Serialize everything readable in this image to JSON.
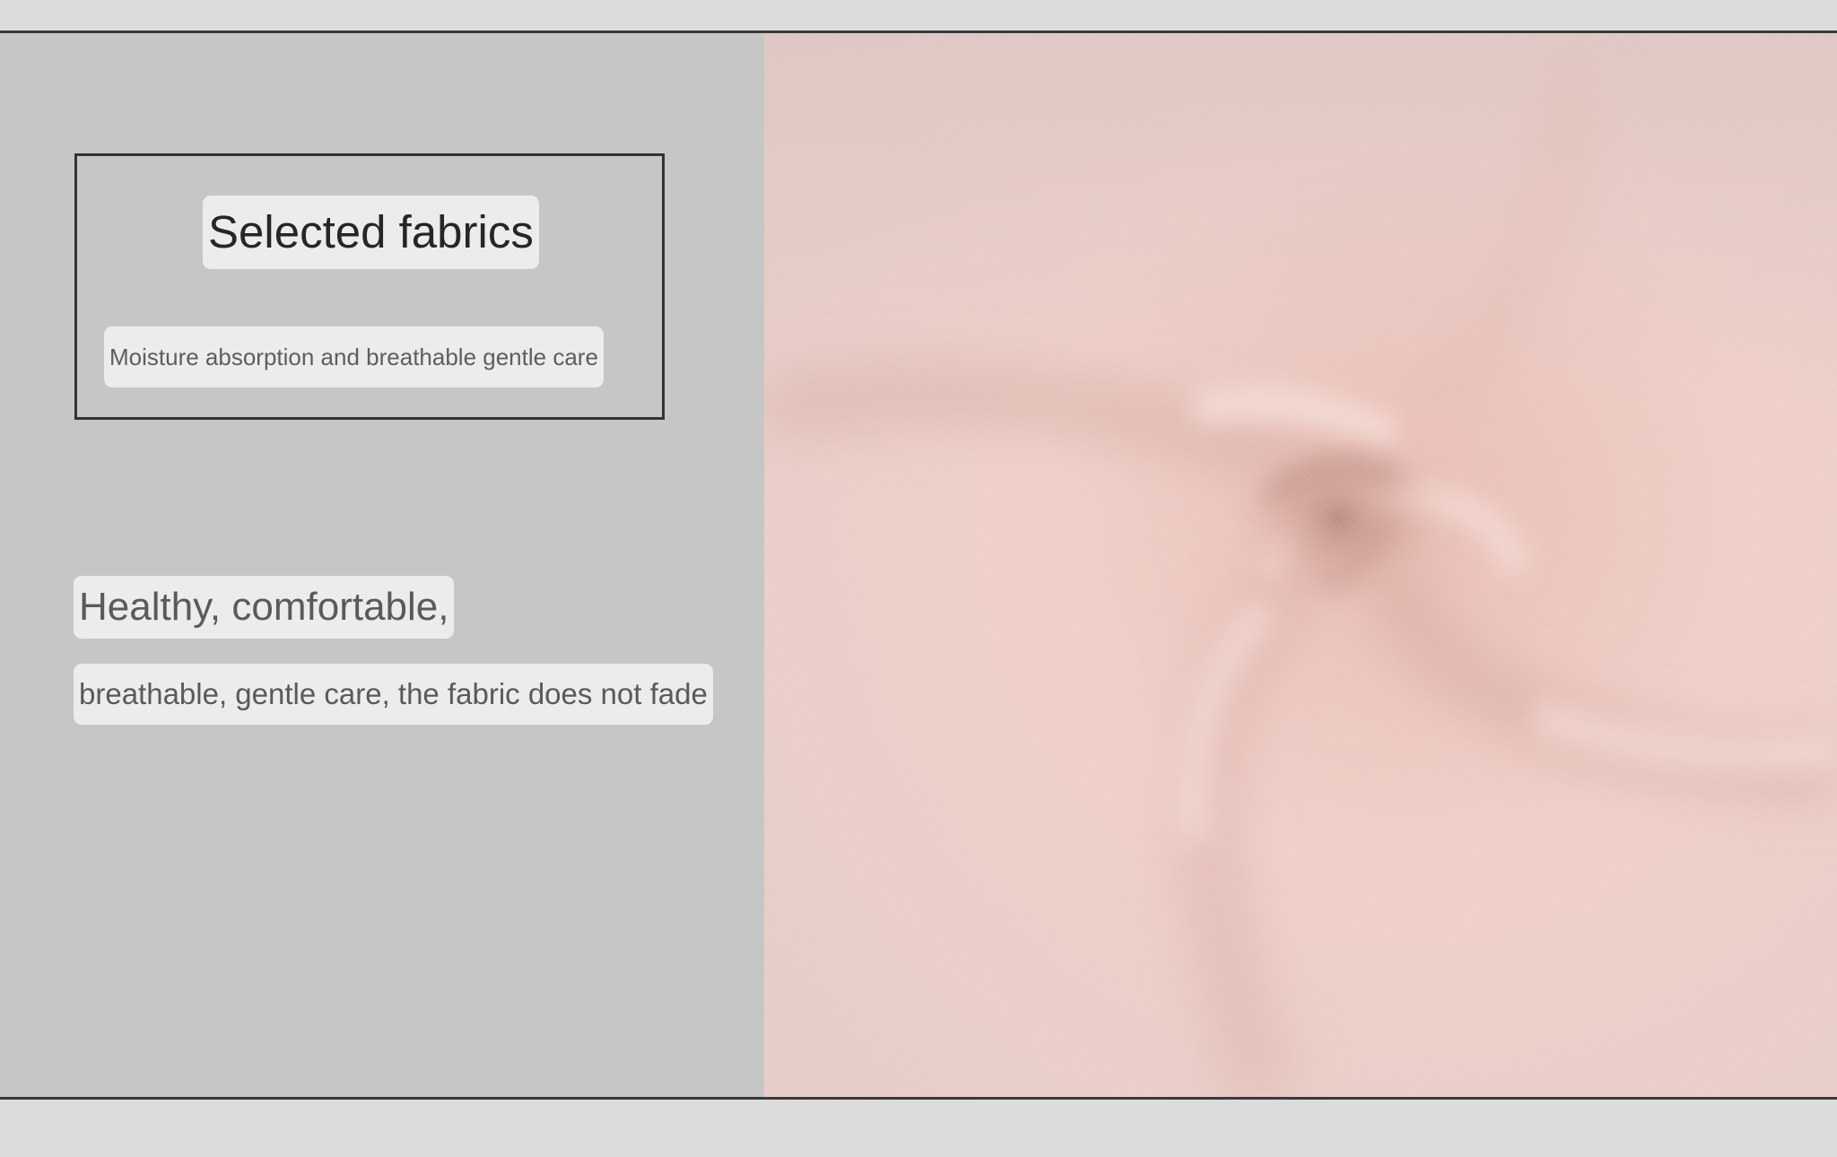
{
  "header_box": {
    "title": "Selected fabrics",
    "subtitle": "Moisture absorption and breathable gentle care"
  },
  "feature": {
    "headline": "Healthy, comfortable,",
    "description": "breathable, gentle care, the fabric does not fade"
  },
  "image": {
    "subject": "pink cotton fabric swirl",
    "colors": {
      "fabric_light": "#efd5cf",
      "fabric_mid": "#e8c2b9",
      "fabric_shadow": "#c99c92",
      "panel_gray": "#c6c6c6",
      "page_gray": "#dcdcdc",
      "rule": "#3a3a3a"
    }
  }
}
